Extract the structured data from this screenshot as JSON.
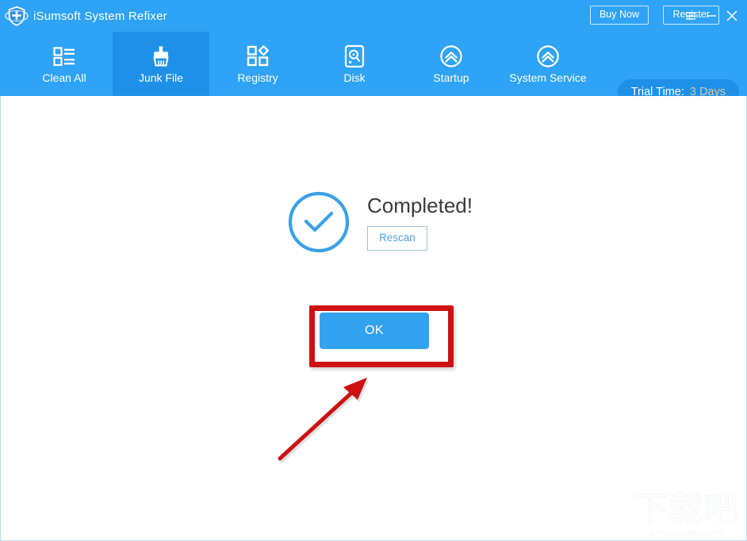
{
  "window": {
    "app_title": "iSumsoft System Refixer",
    "logo_icon": "shield-plus-icon",
    "buy_now_label": "Buy Now",
    "register_label": "Register",
    "menu_icon": "hamburger-menu-icon",
    "minimize_icon": "minimize-icon",
    "close_icon": "close-icon",
    "header_color": "#2fa3f5",
    "active_tab_color": "#1e90e8"
  },
  "nav": {
    "items": [
      {
        "label": "Clean All",
        "icon": "checklist-icon",
        "active": false
      },
      {
        "label": "Junk File",
        "icon": "broom-icon",
        "active": true
      },
      {
        "label": "Registry",
        "icon": "registry-grid-icon",
        "active": false
      },
      {
        "label": "Disk",
        "icon": "hard-disk-icon",
        "active": false
      },
      {
        "label": "Startup",
        "icon": "chevron-up-circle-icon",
        "active": false
      },
      {
        "label": "System Service",
        "icon": "chevron-up-circle-icon",
        "active": false
      }
    ],
    "trial": {
      "label": "Trial Time:",
      "value": "3 Days",
      "value_color": "#d8c9a0"
    }
  },
  "main": {
    "status_icon": "check-circle-icon",
    "status_title": "Completed!",
    "rescan_label": "Rescan",
    "ok_label": "OK",
    "accent_color": "#33a3f0",
    "annotation": {
      "highlight_color": "#cc1111",
      "arrow_icon": "arrow-up-right-icon"
    }
  },
  "watermark": {
    "text": "下载吧",
    "url": "www.xiazaiba.com"
  }
}
